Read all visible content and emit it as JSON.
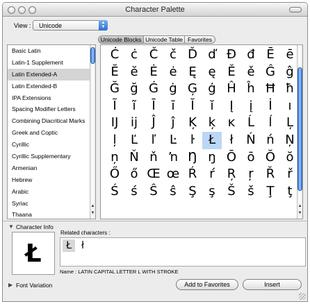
{
  "window": {
    "title": "Character Palette"
  },
  "view": {
    "label": "View :",
    "value": "Unicode"
  },
  "tabs": [
    "Unicode Blocks",
    "Unicode Table",
    "Favorites"
  ],
  "selected_tab": 0,
  "blocks": [
    "Basic Latin",
    "Latin-1 Supplement",
    "Latin Extended-A",
    "Latin Extended-B",
    "IPA Extensions",
    "Spacing Modifier Letters",
    "Combining Diacritical Marks",
    "Greek and Coptic",
    "Cyrillic",
    "Cyrillic Supplementary",
    "Armenian",
    "Hebrew",
    "Arabic",
    "Syriac",
    "Thaana"
  ],
  "selected_block": 2,
  "characters": [
    [
      "Ċ",
      "ċ",
      "Č",
      "č",
      "Ď",
      "ď",
      "Đ",
      "đ",
      "Ē",
      "ē"
    ],
    [
      "Ĕ",
      "ĕ",
      "Ė",
      "ė",
      "Ę",
      "ę",
      "Ě",
      "ě",
      "Ĝ",
      "ĝ"
    ],
    [
      "Ğ",
      "ğ",
      "Ġ",
      "ġ",
      "Ģ",
      "ģ",
      "Ĥ",
      "ĥ",
      "Ħ",
      "ħ"
    ],
    [
      "Ĩ",
      "ĩ",
      "Ī",
      "ī",
      "Ĭ",
      "ĭ",
      "Į",
      "į",
      "İ",
      "ı"
    ],
    [
      "Ĳ",
      "ĳ",
      "Ĵ",
      "ĵ",
      "Ķ",
      "ķ",
      "ĸ",
      "Ĺ",
      "ĺ",
      "Ļ"
    ],
    [
      "ļ",
      "Ľ",
      "ľ",
      "Ŀ",
      "ŀ",
      "Ł",
      "ł",
      "Ń",
      "ń",
      "Ņ"
    ],
    [
      "ņ",
      "Ň",
      "ň",
      "ŉ",
      "Ŋ",
      "ŋ",
      "Ō",
      "ō",
      "Ŏ",
      "ŏ"
    ],
    [
      "Ő",
      "ő",
      "Œ",
      "œ",
      "Ŕ",
      "ŕ",
      "Ŗ",
      "ŗ",
      "Ř",
      "ř"
    ],
    [
      "Ś",
      "ś",
      "Ŝ",
      "ŝ",
      "Ş",
      "ş",
      "Š",
      "š",
      "Ţ",
      "ţ"
    ]
  ],
  "selected_char": {
    "row": 5,
    "col": 5
  },
  "character_info": {
    "header": "Character Info",
    "glyph": "Ł",
    "related_label": "Related characters :",
    "related": [
      "Ł",
      "ł"
    ],
    "name_line": "Name :  LATIN CAPITAL LETTER L WITH STROKE"
  },
  "font_variation": "Font Variation",
  "buttons": {
    "add_favorites": "Add to Favorites",
    "insert": "Insert"
  }
}
